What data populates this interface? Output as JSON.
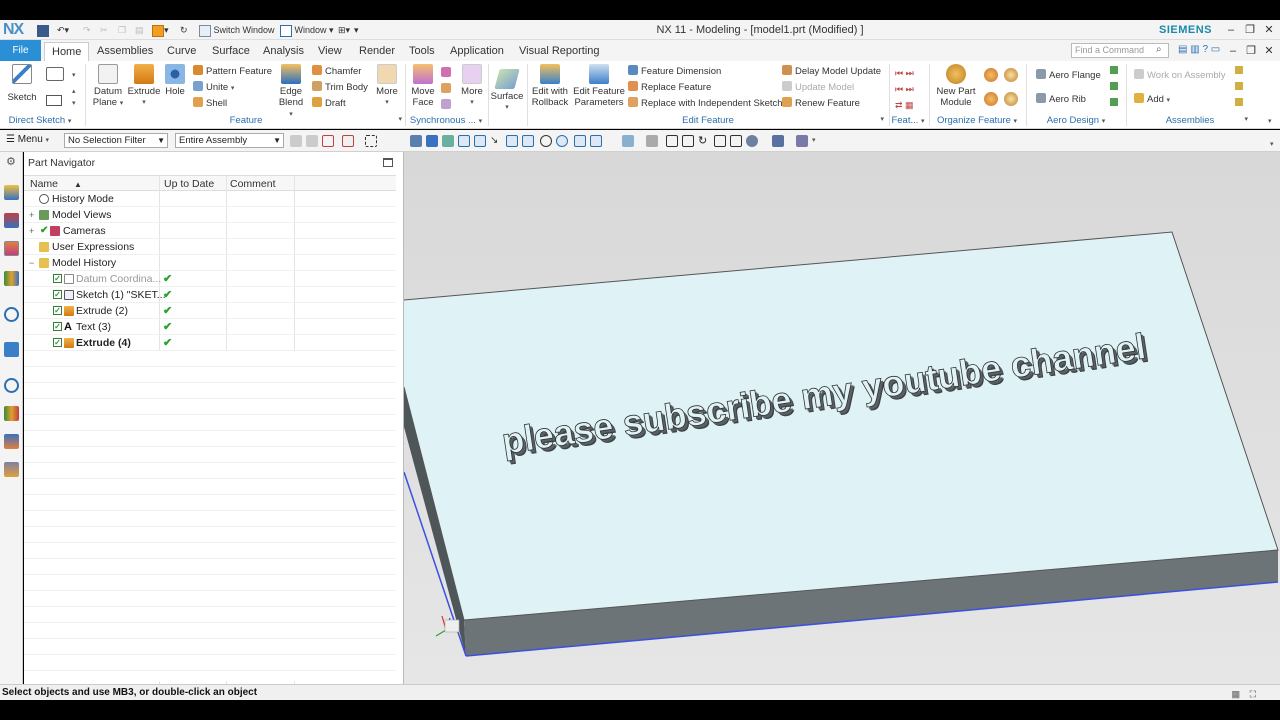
{
  "app": {
    "logo": "NX",
    "title": "NX 11 - Modeling - [model1.prt (Modified) ]",
    "brand": "SIEMENS",
    "quick_access": {
      "switch_window": "Switch Window",
      "window": "Window"
    }
  },
  "tabs": {
    "file": "File",
    "items": [
      "Home",
      "Assemblies",
      "Curve",
      "Surface",
      "Analysis",
      "View",
      "Render",
      "Tools",
      "Application",
      "Visual Reporting"
    ],
    "active": "Home",
    "search_placeholder": "Find a Command"
  },
  "ribbon": {
    "direct_sketch": {
      "sketch": "Sketch",
      "group": "Direct Sketch"
    },
    "feature": {
      "datum_plane": "Datum Plane",
      "datum_1": "Datum",
      "datum_2": "Plane",
      "extrude": "Extrude",
      "hole": "Hole",
      "pattern_feature": "Pattern Feature",
      "unite": "Unite",
      "shell": "Shell",
      "edge_blend_1": "Edge",
      "edge_blend_2": "Blend",
      "chamfer": "Chamfer",
      "trim_body": "Trim Body",
      "draft": "Draft",
      "more": "More",
      "group": "Feature"
    },
    "synchronous": {
      "move_face_1": "Move",
      "move_face_2": "Face",
      "more": "More",
      "group": "Synchronous ..."
    },
    "surface": {
      "label": "Surface"
    },
    "edit_feature": {
      "edit_rollback_1": "Edit with",
      "edit_rollback_2": "Rollback",
      "edit_params_1": "Edit Feature",
      "edit_params_2": "Parameters",
      "feature_dimension": "Feature Dimension",
      "replace_feature": "Replace Feature",
      "replace_independent": "Replace with Independent Sketch",
      "delay_update": "Delay Model Update",
      "update_model": "Update Model",
      "renew_feature": "Renew Feature",
      "group": "Edit Feature"
    },
    "feat_group": "Feat...",
    "organize": {
      "new_part_1": "New Part",
      "new_part_2": "Module",
      "group": "Organize Feature"
    },
    "aero": {
      "aero_flange": "Aero Flange",
      "aero_rib": "Aero Rib",
      "group": "Aero Design"
    },
    "assemblies": {
      "work_on_assembly": "Work on Assembly",
      "add": "Add",
      "group": "Assemblies"
    }
  },
  "toolbar": {
    "menu": "Menu",
    "selection_filter": "No Selection Filter",
    "scope": "Entire Assembly"
  },
  "navigator": {
    "title": "Part Navigator",
    "columns": {
      "name": "Name",
      "up_to_date": "Up to Date",
      "comment": "Comment"
    },
    "rows": [
      {
        "label": "History Mode"
      },
      {
        "label": "Model Views"
      },
      {
        "label": "Cameras"
      },
      {
        "label": "User Expressions"
      },
      {
        "label": "Model History"
      },
      {
        "label": "Datum Coordina..."
      },
      {
        "label": "Sketch (1) \"SKET..."
      },
      {
        "label": "Extrude (2)"
      },
      {
        "label": "Text (3)"
      },
      {
        "label": "Extrude (4)"
      }
    ]
  },
  "model": {
    "embossed_text": "please subscribe my youtube channel",
    "top_color": "#dff3f7",
    "side_color": "#6c7477"
  },
  "status": {
    "message": "Select objects and use MB3, or double-click an object"
  }
}
